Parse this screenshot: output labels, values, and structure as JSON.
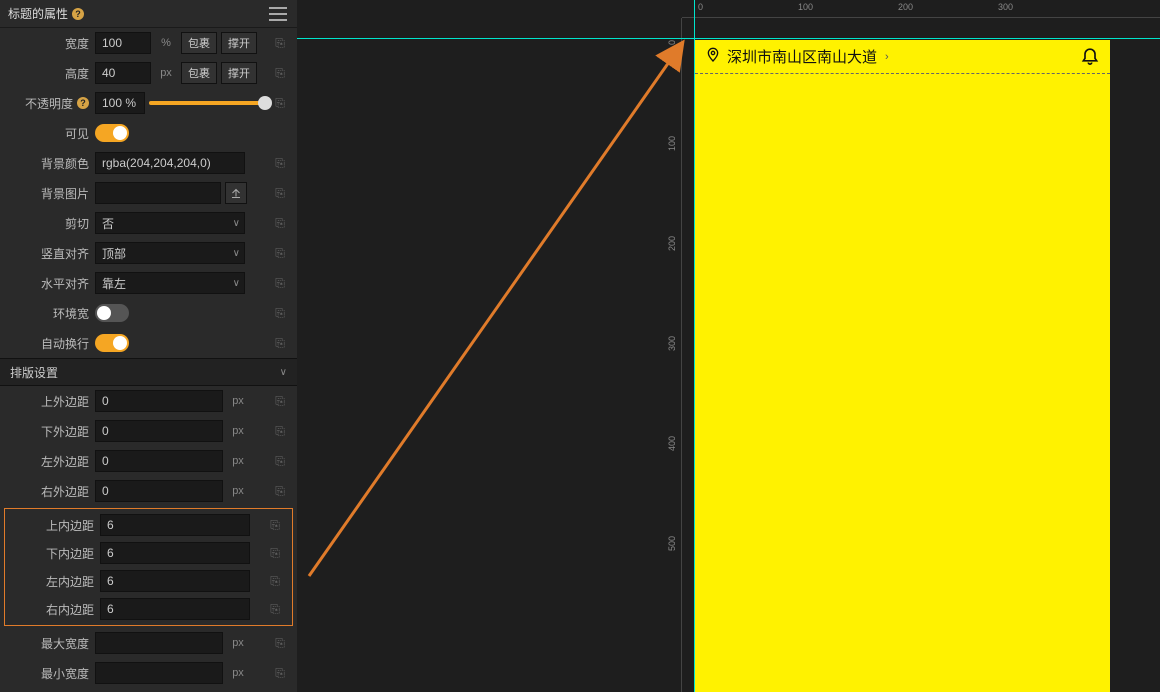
{
  "panel": {
    "title": "标题的属性",
    "props": {
      "width": {
        "label": "宽度",
        "value": "100",
        "unit": "%",
        "btnWrap": "包裹",
        "btnExpand": "撑开"
      },
      "height": {
        "label": "高度",
        "value": "40",
        "unit": "px",
        "btnWrap": "包裹",
        "btnExpand": "撑开"
      },
      "opacity": {
        "label": "不透明度",
        "value": "100 %",
        "slider_percent": 100
      },
      "visible": {
        "label": "可见",
        "on": true
      },
      "bgcolor": {
        "label": "背景颜色",
        "value": "rgba(204,204,204,0)"
      },
      "bgimage": {
        "label": "背景图片",
        "value": ""
      },
      "clip": {
        "label": "剪切",
        "value": "否"
      },
      "valign": {
        "label": "竖直对齐",
        "value": "顶部"
      },
      "halign": {
        "label": "水平对齐",
        "value": "靠左"
      },
      "envwidth": {
        "label": "环境宽",
        "on": false
      },
      "autowrap": {
        "label": "自动换行",
        "on": true
      }
    },
    "layoutSection": "排版设置",
    "margins": {
      "top": {
        "label": "上外边距",
        "value": "0",
        "unit": "px"
      },
      "bottom": {
        "label": "下外边距",
        "value": "0",
        "unit": "px"
      },
      "left": {
        "label": "左外边距",
        "value": "0",
        "unit": "px"
      },
      "right": {
        "label": "右外边距",
        "value": "0",
        "unit": "px"
      }
    },
    "paddings": {
      "top": {
        "label": "上内边距",
        "value": "6"
      },
      "bottom": {
        "label": "下内边距",
        "value": "6"
      },
      "left": {
        "label": "左内边距",
        "value": "6"
      },
      "right": {
        "label": "右内边距",
        "value": "6"
      }
    },
    "maxwidth": {
      "label": "最大宽度",
      "value": "",
      "unit": "px"
    },
    "minwidth": {
      "label": "最小宽度",
      "value": "",
      "unit": "px"
    }
  },
  "ruler": {
    "h": [
      "0",
      "100",
      "200",
      "300"
    ],
    "v": [
      "0",
      "100",
      "200",
      "300",
      "400",
      "500"
    ]
  },
  "preview": {
    "location_text": "深圳市南山区南山大道"
  }
}
